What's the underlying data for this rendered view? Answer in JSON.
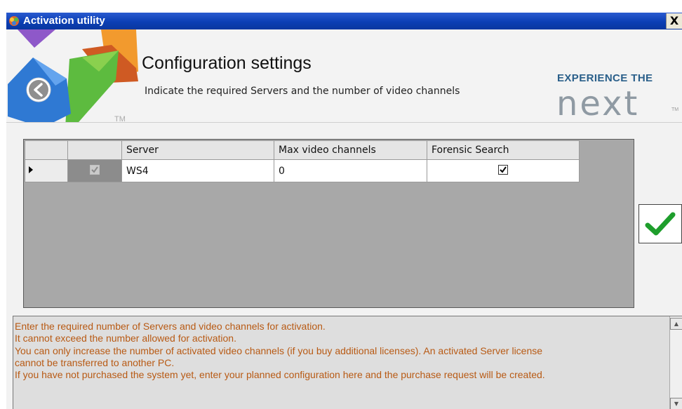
{
  "window": {
    "title": "Activation utility",
    "close_label": "X"
  },
  "header": {
    "title": "Configuration settings",
    "subtitle": "Indicate the required Servers and the number of video channels",
    "trademark": "TM",
    "brand_tagline": "EXPERIENCE THE",
    "brand_word": "next",
    "brand_tm": "TM"
  },
  "grid": {
    "columns": [
      "Server",
      "Max video channels",
      "Forensic Search"
    ],
    "rows": [
      {
        "selected": true,
        "server": "WS4",
        "max_video_channels": "0",
        "forensic_search": true
      }
    ]
  },
  "messages": [
    "Enter the required number of Servers and video channels for activation.",
    "It cannot exceed the number allowed for activation.",
    "You can only increase the number of activated video channels (if you buy additional licenses). An activated Server license",
    "cannot be transferred to another PC.",
    "If you have not purchased the system yet, enter your planned configuration here and the purchase request  will be created."
  ],
  "colors": {
    "titlebar": "#0b3fb4",
    "message_text": "#b85a14",
    "confirm_check": "#1e9e2c",
    "grid_background": "#a8a8a8"
  },
  "icons": {
    "back": "back-arrow-icon",
    "confirm": "checkmark-icon",
    "app": "app-icon"
  }
}
